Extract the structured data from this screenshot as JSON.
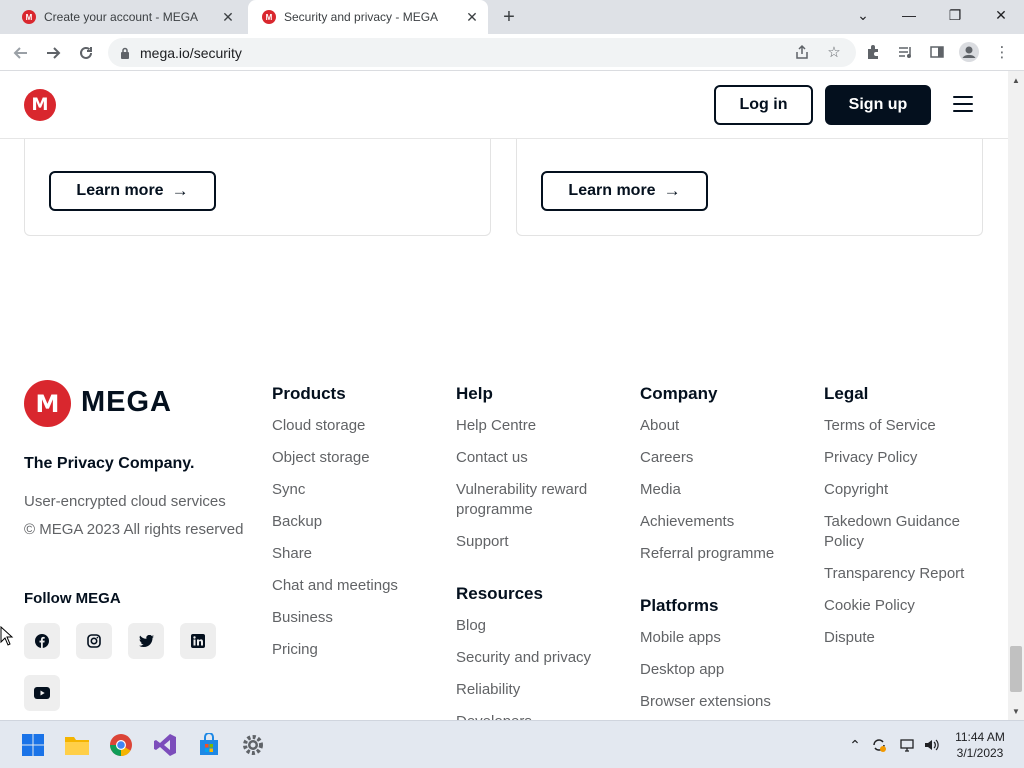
{
  "browser": {
    "tabs": [
      {
        "title": "Create your account - MEGA",
        "active": false
      },
      {
        "title": "Security and privacy - MEGA",
        "active": true
      }
    ],
    "new_tab_symbol": "+",
    "url": "mega.io/security",
    "window_controls": {
      "dropdown": "⌄",
      "minimize": "—",
      "restore": "❐",
      "close": "✕"
    }
  },
  "header": {
    "logo_letter": "M",
    "login_label": "Log in",
    "signup_label": "Sign up"
  },
  "cards": [
    {
      "button_label": "Learn more"
    },
    {
      "button_label": "Learn more"
    }
  ],
  "footer": {
    "brand_name": "MEGA",
    "tagline": "The Privacy Company.",
    "description": "User-encrypted cloud services",
    "copyright": "© MEGA 2023 All rights reserved",
    "follow_label": "Follow MEGA",
    "social": [
      {
        "name": "facebook-icon"
      },
      {
        "name": "instagram-icon"
      },
      {
        "name": "twitter-icon"
      },
      {
        "name": "linkedin-icon"
      },
      {
        "name": "youtube-icon"
      }
    ],
    "columns": {
      "products": {
        "title": "Products",
        "links": [
          "Cloud storage",
          "Object storage",
          "Sync",
          "Backup",
          "Share",
          "Chat and meetings",
          "Business",
          "Pricing"
        ]
      },
      "help": {
        "title": "Help",
        "links": [
          "Help Centre",
          "Contact us",
          "Vulnerability reward programme",
          "Support"
        ]
      },
      "resources": {
        "title": "Resources",
        "links": [
          "Blog",
          "Security and privacy",
          "Reliability",
          "Developers"
        ]
      },
      "company": {
        "title": "Company",
        "links": [
          "About",
          "Careers",
          "Media",
          "Achievements",
          "Referral programme"
        ]
      },
      "platforms": {
        "title": "Platforms",
        "links": [
          "Mobile apps",
          "Desktop app",
          "Browser extensions"
        ]
      },
      "legal": {
        "title": "Legal",
        "links": [
          "Terms of Service",
          "Privacy Policy",
          "Copyright",
          "Takedown Guidance Policy",
          "Transparency Report",
          "Cookie Policy",
          "Dispute"
        ]
      }
    }
  },
  "taskbar": {
    "time": "11:44 AM",
    "date": "3/1/2023"
  },
  "colors": {
    "brand_red": "#d9272e",
    "dark": "#04101e",
    "muted": "#616366"
  }
}
